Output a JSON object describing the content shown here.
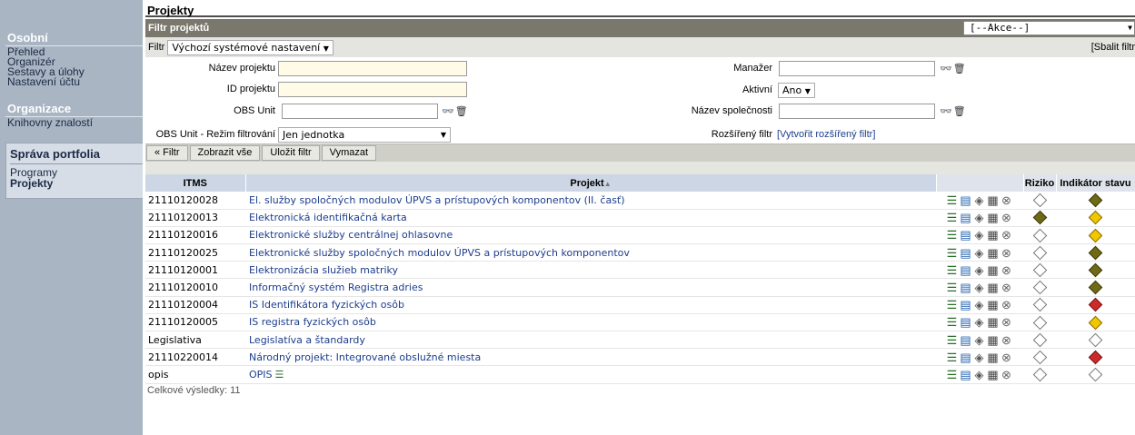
{
  "sidebar": {
    "section1": "Osobní",
    "items1": [
      "Přehled",
      "Organizér",
      "Sestavy a úlohy",
      "Nastavení účtu"
    ],
    "section2": "Organizace",
    "items2": [
      "Knihovny znalostí"
    ],
    "section3": "Správa portfolia",
    "items3": [
      "Programy",
      "Projekty"
    ]
  },
  "page": {
    "title": "Projekty"
  },
  "filter": {
    "header": "Filtr projektů",
    "actions_value": "[--Akce--]",
    "filter_label": "Filtr",
    "filter_value": "Výchozí systémové nastavení",
    "collapse_link": "[Sbalit filtr",
    "fields": {
      "project_name_label": "Název projektu",
      "project_id_label": "ID projektu",
      "obs_unit_label": "OBS Unit",
      "obs_mode_label": "OBS Unit - Režim filtrování",
      "obs_mode_value": "Jen jednotka",
      "manager_label": "Manažer",
      "active_label": "Aktivní",
      "active_value": "Ano",
      "company_label": "Název společnosti",
      "extended_label": "Rozšířený filtr",
      "extended_link": "[Vytvořit rozšířený filtr]"
    },
    "buttons": {
      "filter": "« Filtr",
      "show_all": "Zobrazit vše",
      "save": "Uložit filtr",
      "clear": "Vymazat"
    }
  },
  "table": {
    "headers": {
      "itms": "ITMS",
      "project": "Projekt",
      "risk": "Riziko",
      "status": "Indikátor stavu"
    },
    "rows": [
      {
        "itms": "21110120028",
        "name": "El. služby spoločných modulov ÚPVS a prístupových komponentov (II. časť)",
        "risk": "empty",
        "status": "olive"
      },
      {
        "itms": "21110120013",
        "name": "Elektronická identifikačná karta",
        "risk": "olive",
        "status": "yellow"
      },
      {
        "itms": "21110120016",
        "name": "Elektronické služby centrálnej ohlasovne",
        "risk": "empty",
        "status": "yellow"
      },
      {
        "itms": "21110120025",
        "name": "Elektronické služby spoločných modulov ÚPVS a prístupových komponentov",
        "risk": "empty",
        "status": "olive"
      },
      {
        "itms": "21110120001",
        "name": "Elektronizácia služieb matriky",
        "risk": "empty",
        "status": "olive"
      },
      {
        "itms": "21110120010",
        "name": "Informačný systém Registra adries",
        "risk": "empty",
        "status": "olive"
      },
      {
        "itms": "21110120004",
        "name": "IS Identifikátora fyzických osôb",
        "risk": "empty",
        "status": "red"
      },
      {
        "itms": "21110120005",
        "name": "IS registra fyzických osôb",
        "risk": "empty",
        "status": "yellow"
      },
      {
        "itms": "Legislativa",
        "name": "Legislatíva a štandardy",
        "risk": "empty",
        "status": "empty"
      },
      {
        "itms": "21110220014",
        "name": "Národný projekt: Integrované obslužné miesta",
        "risk": "empty",
        "status": "red"
      },
      {
        "itms": "opis",
        "name": "OPIS",
        "risk": "empty",
        "status": "empty"
      }
    ],
    "total": "Celkové výsledky: 11"
  },
  "colors": {
    "sidebar": "#a9b5c3",
    "filter_header": "#7a776c",
    "link": "#1c3d8c",
    "grid_header": "#cdd6e4"
  }
}
